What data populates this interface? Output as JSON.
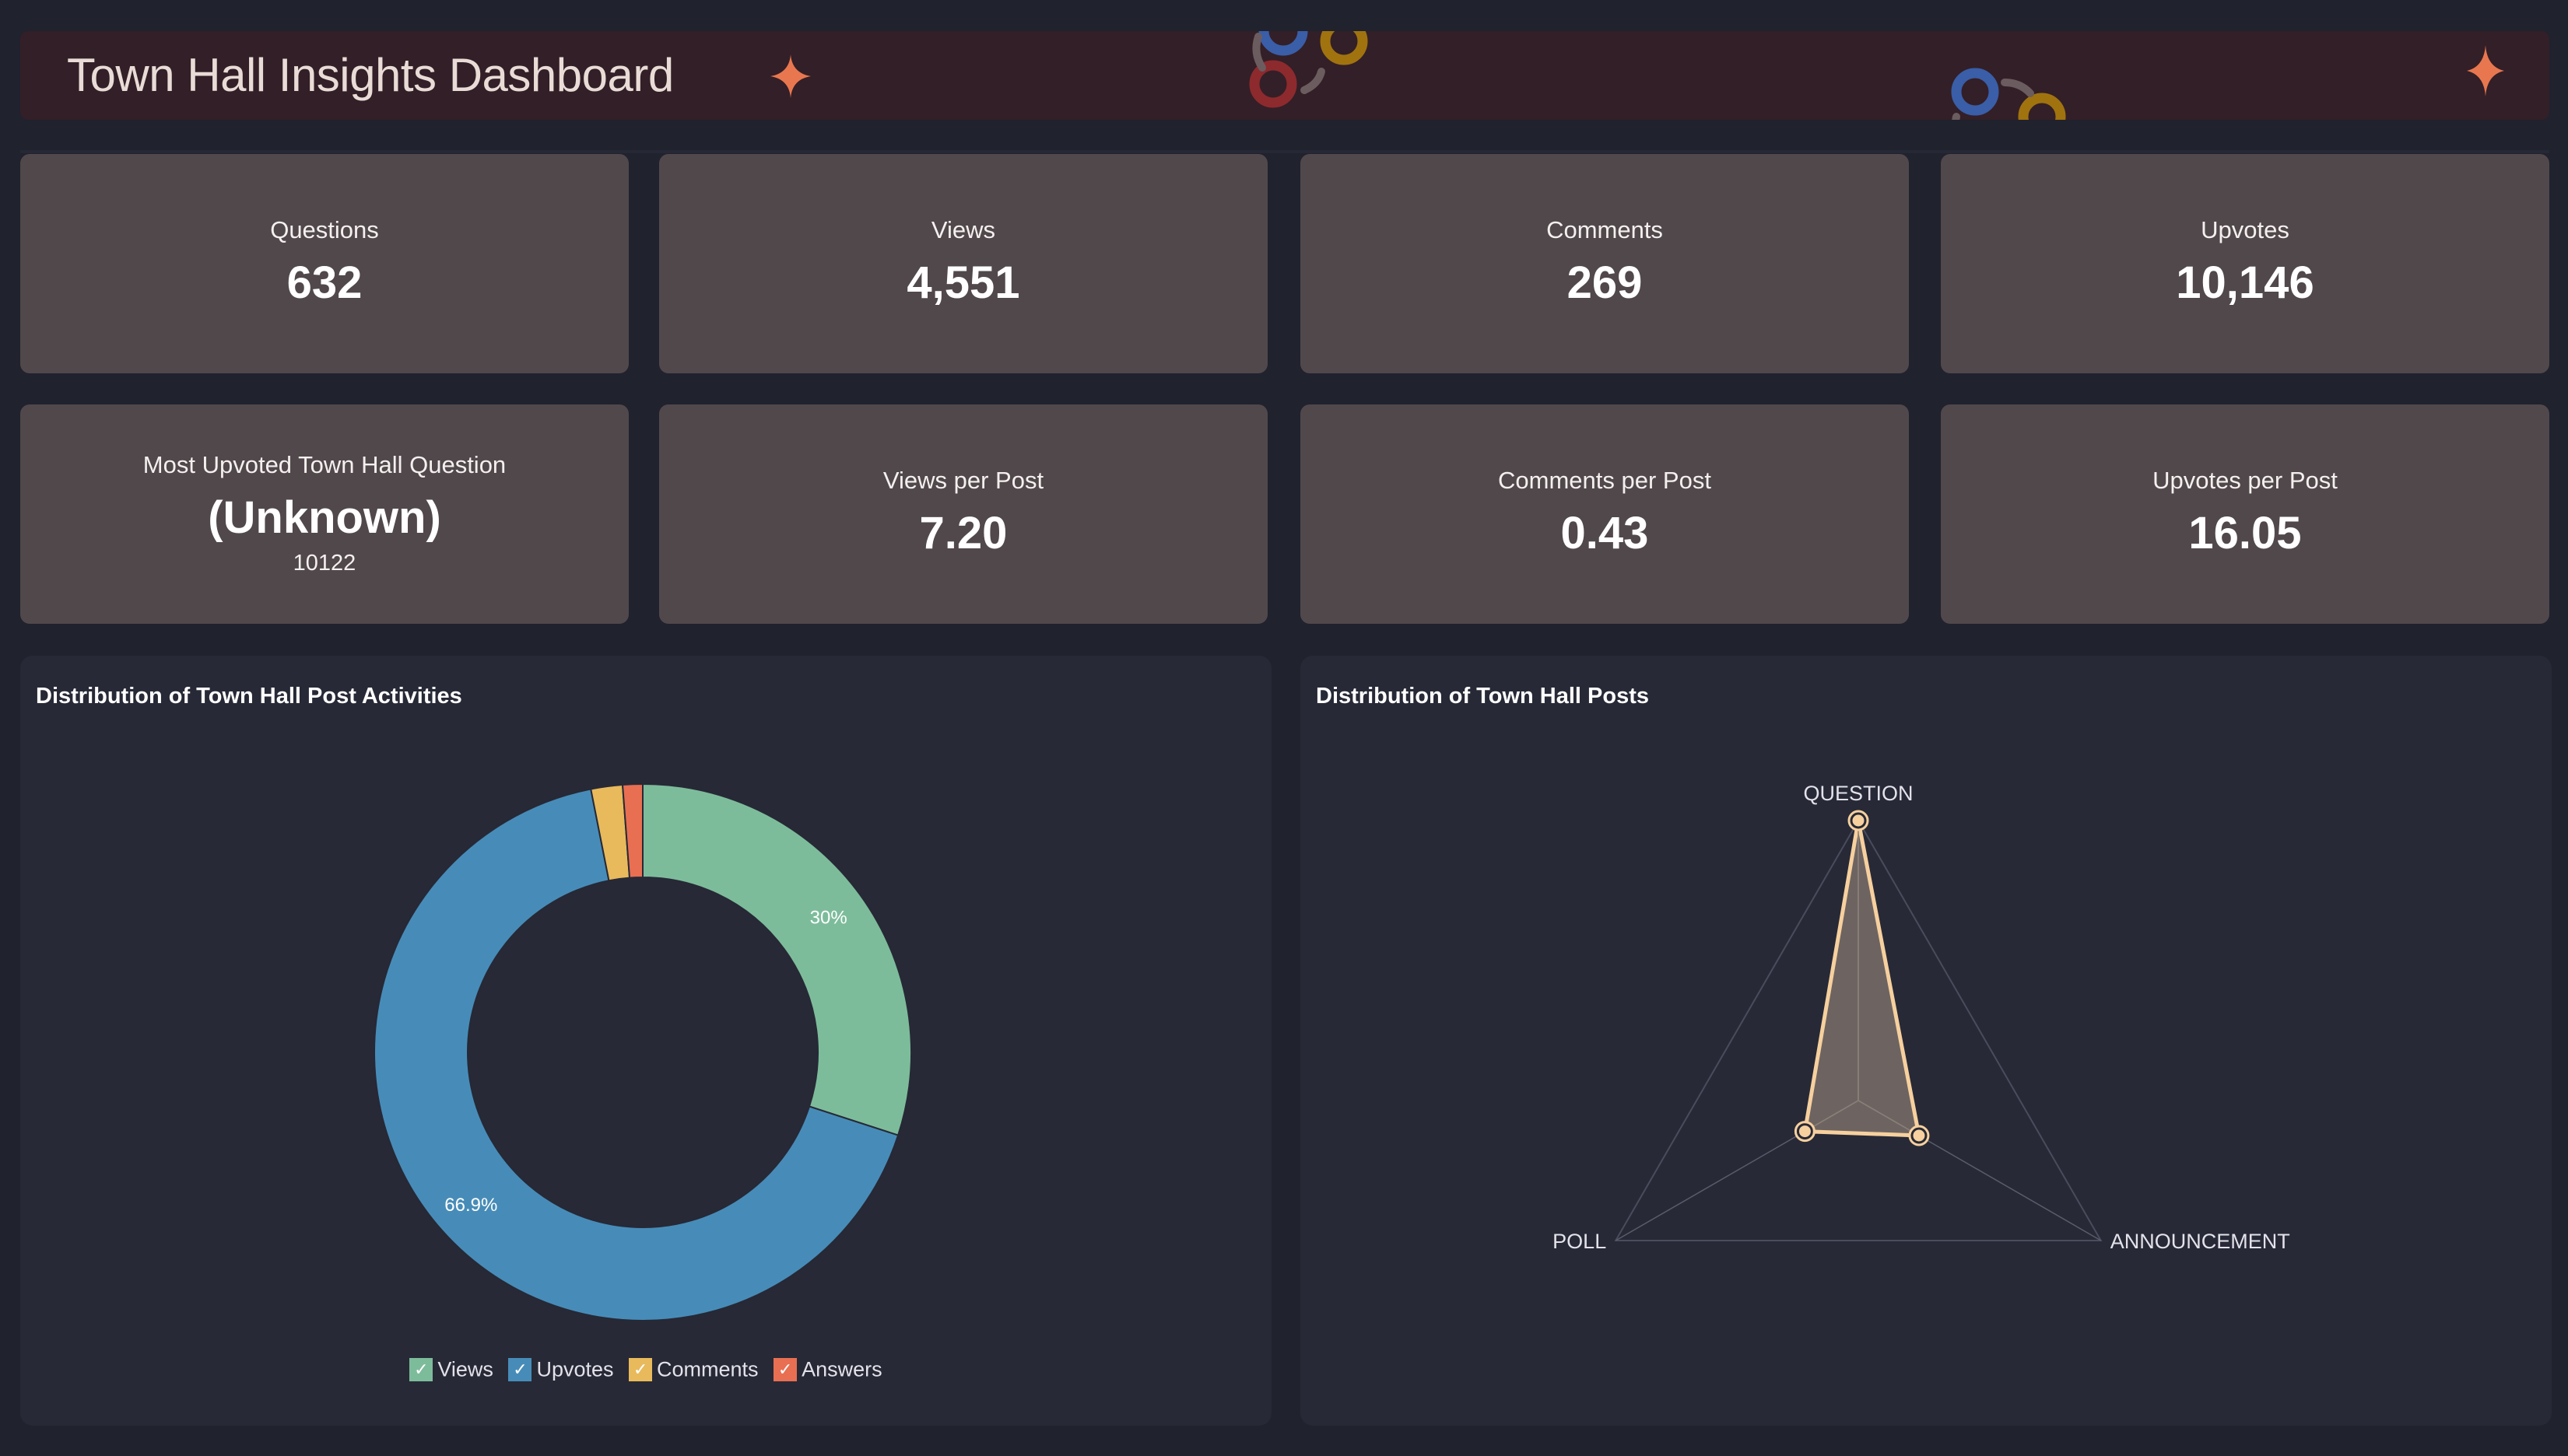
{
  "header": {
    "title": "Town Hall Insights Dashboard",
    "accent_color": "#e8774f"
  },
  "kpis": [
    {
      "label": "Questions",
      "value": "632"
    },
    {
      "label": "Views",
      "value": "4,551"
    },
    {
      "label": "Comments",
      "value": "269"
    },
    {
      "label": "Upvotes",
      "value": "10,146"
    }
  ],
  "kpis_row2": [
    {
      "label": "Most Upvoted Town Hall Question",
      "value": "(Unknown)",
      "sub": "10122"
    },
    {
      "label": "Views per Post",
      "value": "7.20"
    },
    {
      "label": "Comments per Post",
      "value": "0.43"
    },
    {
      "label": "Upvotes per Post",
      "value": "16.05"
    }
  ],
  "chart_data": [
    {
      "type": "pie",
      "title": "Distribution of Town Hall Post Activities",
      "donut": true,
      "categories": [
        "Views",
        "Upvotes",
        "Comments",
        "Answers"
      ],
      "values": [
        30.0,
        66.9,
        1.9,
        1.2
      ],
      "data_labels": [
        "30%",
        "66.9%",
        "",
        ""
      ],
      "colors": [
        "#7dbc9b",
        "#478cb8",
        "#e8ba5c",
        "#e86f52"
      ],
      "legend": "bottom",
      "legend_checked": [
        true,
        true,
        true,
        true
      ]
    },
    {
      "type": "radar",
      "title": "Distribution of Town Hall Posts",
      "axes": [
        "QUESTION",
        "ANNOUNCEMENT",
        "POLL"
      ],
      "values": [
        1.0,
        0.25,
        0.22
      ],
      "range": [
        0,
        1
      ],
      "series_color": "#f6d09e"
    }
  ]
}
